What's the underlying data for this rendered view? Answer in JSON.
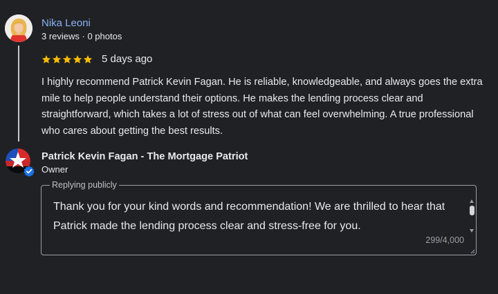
{
  "review": {
    "reviewer_name": "Nika Leoni",
    "reviewer_meta": "3 reviews · 0 photos",
    "rating": 5,
    "date": "5 days ago",
    "text": "I highly recommend Patrick Kevin Fagan. He is reliable, knowledgeable, and always goes the extra mile to help people understand their options. He makes the lending process clear and straightforward, which takes a lot of stress out of what can feel overwhelming. A true professional who cares about getting the best results."
  },
  "owner": {
    "name": "Patrick Kevin Fagan - The Mortgage Patriot",
    "role": "Owner",
    "avatar_icon": "star-flag-logo-icon",
    "verified_icon": "verified-badge-icon"
  },
  "reply": {
    "label": "Replying publicly",
    "text": "Thank you for your kind words and recommendation! We are thrilled to hear that Patrick made the lending process clear and stress-free for you.",
    "char_count": "299/4,000"
  },
  "colors": {
    "background": "#202124",
    "reviewer_name": "#8ab4f8",
    "star": "#fbbc04",
    "text": "#e8eaed",
    "border": "#9aa0a6",
    "verified_badge": "#1a73e8"
  }
}
